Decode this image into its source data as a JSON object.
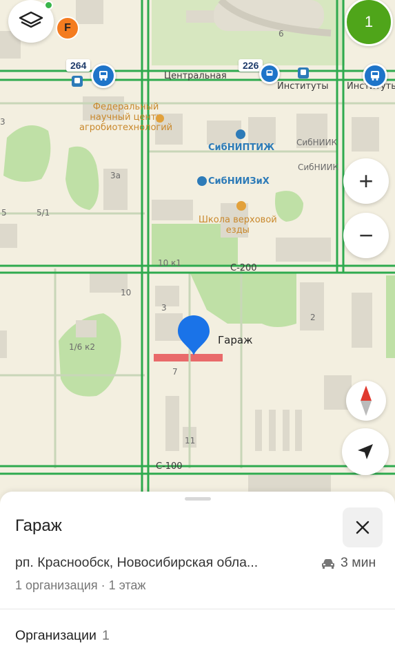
{
  "map": {
    "routes": [
      {
        "number": "264"
      },
      {
        "number": "226"
      }
    ],
    "streets": {
      "central": "Центральная",
      "s200": "С-200",
      "s100": "С-100"
    },
    "stops": {
      "instituty_1": "Институты",
      "instituty_2": "Институты"
    },
    "pois": {
      "research_center": "Федеральный\nнаучный центр\nагробиотехнологий",
      "sibniptizh": "СибНИПТИЖ",
      "sibniiziH": "СибНИИЗиХ",
      "riding_school": "Школа верховой\nезды",
      "sibniik_1": "СибНИИК",
      "sibniik_2": "СибНИИК"
    },
    "house_numbers": [
      "6",
      "3а",
      "5",
      "5/1",
      "10 к1",
      "10",
      "3",
      "2",
      "1/6 к2",
      "7",
      "11",
      "3"
    ],
    "marker_label": "Гараж",
    "controls": {
      "badge_count": "1",
      "avatar_letter": "F",
      "zoom_in": "+",
      "zoom_out": "−"
    }
  },
  "sheet": {
    "title": "Гараж",
    "address": "рп. Краснообск, Новосибирская обла...",
    "eta": "3 мин",
    "meta": "1 организация · 1 этаж",
    "orgs_label": "Организации",
    "orgs_count": "1"
  },
  "colors": {
    "road": "#2eaa4e",
    "bus": "#1e74c9",
    "park": "#bcdfa2",
    "building": "#ddd9cc",
    "marker": "#1a73e8",
    "accent_green": "#4fa51a",
    "avatar_orange": "#f47c20"
  }
}
